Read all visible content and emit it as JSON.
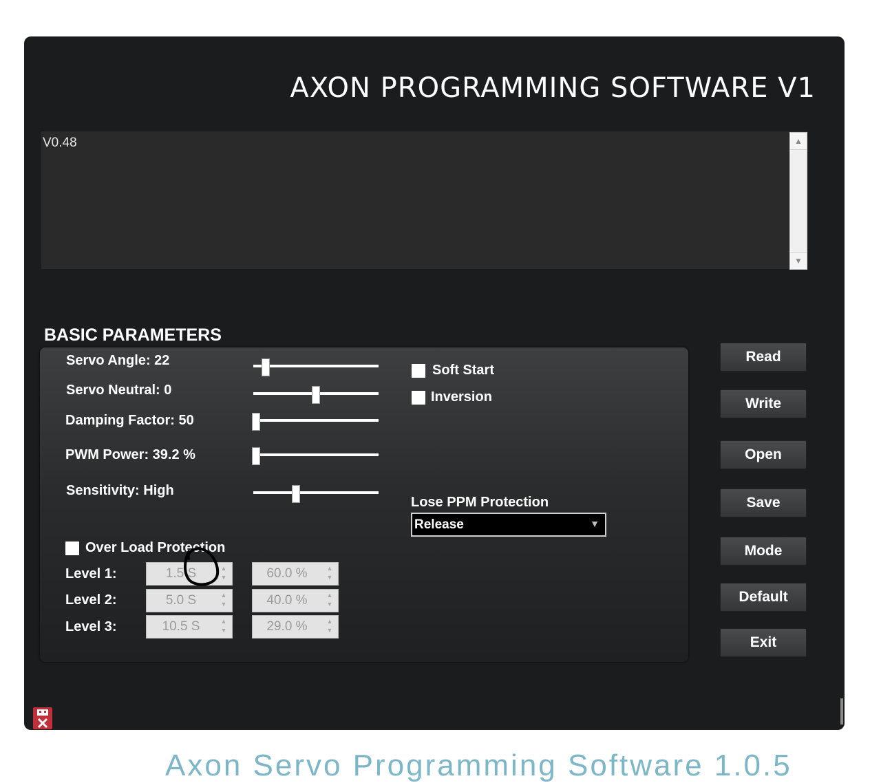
{
  "window": {
    "title": "AXON PROGRAMMING SOFTWARE V1",
    "log_text": "V0.48"
  },
  "basic_parameters": {
    "heading": "BASIC PARAMETERS",
    "sliders": [
      {
        "label": "Servo Angle: 22",
        "level": 0.07
      },
      {
        "label": "Servo Neutral: 0",
        "level": 0.5
      },
      {
        "label": "Damping Factor: 50",
        "level": 0.0
      },
      {
        "label": "PWM Power: 39.2 %",
        "level": 0.0
      },
      {
        "label": "Sensitivity: High",
        "level": 0.33
      }
    ],
    "soft_start_label": "Soft Start",
    "inversion_label": "Inversion",
    "lose_ppm": {
      "label": "Lose PPM Protection",
      "selected": "Release"
    },
    "overload": {
      "label": "Over Load Protection",
      "levels": [
        {
          "label": "Level 1:",
          "time": "1.5 S",
          "power": "60.0 %"
        },
        {
          "label": "Level 2:",
          "time": "5.0 S",
          "power": "40.0 %"
        },
        {
          "label": "Level 3:",
          "time": "10.5 S",
          "power": "29.0 %"
        }
      ]
    }
  },
  "buttons": [
    "Read",
    "Write",
    "Open",
    "Save",
    "Mode",
    "Default",
    "Exit"
  ],
  "caption": "Axon Servo Programming Software 1.0.5",
  "colors": {
    "window_bg": "#1b1c1e",
    "panel_bg": "#2b2c2d",
    "caption": "#7db6c7"
  }
}
